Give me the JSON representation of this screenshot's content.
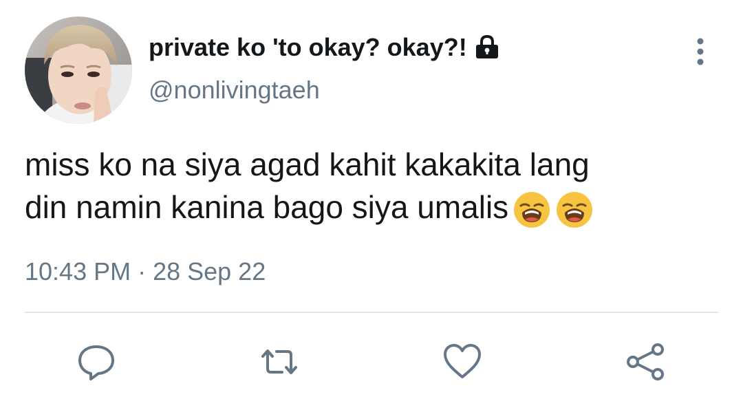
{
  "user": {
    "display_name": "private ko 'to okay? okay?!",
    "handle": "@nonlivingtaeh",
    "protected": true
  },
  "tweet": {
    "lines": [
      "miss ko na siya agad kahit kakakita lang",
      "din namin kanina bago siya umalis"
    ],
    "emojis": [
      "weary-face",
      "weary-face"
    ],
    "timestamp": "10:43 PM · 28 Sep 22"
  },
  "actions": {
    "icons": [
      "reply-icon",
      "retweet-icon",
      "like-icon",
      "share-icon"
    ]
  },
  "colors": {
    "text": "#14171a",
    "secondary": "#657786",
    "divider": "#e1e8ed",
    "icon": "#657786"
  }
}
